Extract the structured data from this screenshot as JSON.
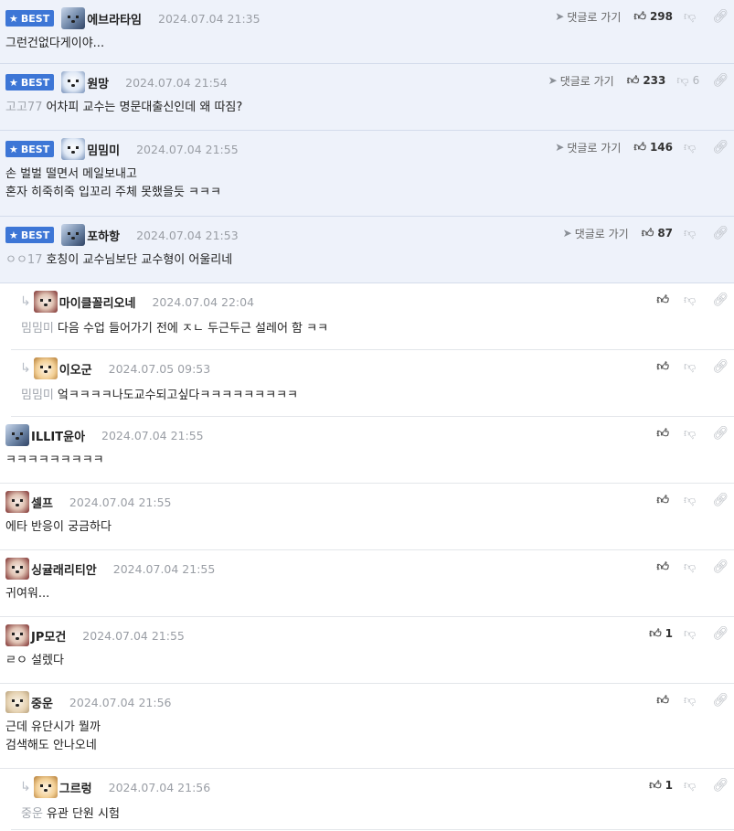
{
  "labels": {
    "best": "BEST",
    "goto": "댓글로 가기"
  },
  "icons": {
    "best_star": "star-icon",
    "goto": "send-arrow-icon",
    "up": "thumbs-up-icon",
    "down": "thumbs-down-icon",
    "link": "link-icon",
    "reply": "reply-arrow-icon"
  },
  "colors": {
    "best_badge": "#3d76d6",
    "best_bg": "#eef2fa"
  },
  "comments": [
    {
      "best": true,
      "reply": false,
      "avatar": "blue",
      "nick": "에브라타임",
      "date": "2024.07.04 21:35",
      "mention": "",
      "lines": [
        "그런건없다게이야..."
      ],
      "goto": true,
      "up": "298",
      "down": ""
    },
    {
      "best": true,
      "reply": false,
      "avatar": "white",
      "nick": "원망",
      "date": "2024.07.04 21:54",
      "mention": "고고77",
      "lines": [
        "어차피 교수는 명문대출신인데 왜 따짐?"
      ],
      "goto": true,
      "up": "233",
      "down": "6"
    },
    {
      "best": true,
      "reply": false,
      "avatar": "white",
      "nick": "밈밈미",
      "date": "2024.07.04 21:55",
      "mention": "",
      "lines": [
        "손 벌벌 떨면서 메일보내고",
        "혼자 히죽히죽 입꼬리 주체 못했을듯 ㅋㅋㅋ"
      ],
      "goto": true,
      "up": "146",
      "down": ""
    },
    {
      "best": true,
      "reply": false,
      "avatar": "blue",
      "nick": "포하항",
      "date": "2024.07.04 21:53",
      "mention": "ㅇㅇ17",
      "lines": [
        "호칭이 교수님보단 교수형이 어울리네"
      ],
      "goto": true,
      "up": "87",
      "down": ""
    },
    {
      "best": false,
      "reply": true,
      "avatar": "red",
      "nick": "마이클꼴리오네",
      "date": "2024.07.04 22:04",
      "mention": "밈밈미",
      "lines": [
        "다음 수업 들어가기 전에 ㅈㄴ 두근두근 설레어 함 ㅋㅋ"
      ],
      "goto": false,
      "up": "",
      "down": ""
    },
    {
      "best": false,
      "reply": true,
      "avatar": "fox",
      "nick": "이오군",
      "date": "2024.07.05 09:53",
      "mention": "밈밈미",
      "lines": [
        "엌ㅋㅋㅋㅋ나도교수되고싶다ㅋㅋㅋㅋㅋㅋㅋㅋㅋ"
      ],
      "goto": false,
      "up": "",
      "down": ""
    },
    {
      "best": false,
      "reply": false,
      "avatar": "blue",
      "nick": "ILLIT윤아",
      "date": "2024.07.04 21:55",
      "mention": "",
      "lines": [
        "ㅋㅋㅋㅋㅋㅋㅋㅋㅋ"
      ],
      "goto": false,
      "up": "",
      "down": ""
    },
    {
      "best": false,
      "reply": false,
      "avatar": "red",
      "nick": "셀프",
      "date": "2024.07.04 21:55",
      "mention": "",
      "lines": [
        "에타 반응이 궁금하다"
      ],
      "goto": false,
      "up": "",
      "down": ""
    },
    {
      "best": false,
      "reply": false,
      "avatar": "red",
      "nick": "싱귤래리티안",
      "date": "2024.07.04 21:55",
      "mention": "",
      "lines": [
        "귀여워..."
      ],
      "goto": false,
      "up": "",
      "down": ""
    },
    {
      "best": false,
      "reply": false,
      "avatar": "red",
      "nick": "JP모건",
      "date": "2024.07.04 21:55",
      "mention": "",
      "lines": [
        "ㄹㅇ 설렜다"
      ],
      "goto": false,
      "up": "1",
      "down": ""
    },
    {
      "best": false,
      "reply": false,
      "avatar": "dog",
      "nick": "중운",
      "date": "2024.07.04 21:56",
      "mention": "",
      "lines": [
        "근데 유단시가 뭘까",
        "검색해도 안나오네"
      ],
      "goto": false,
      "up": "",
      "down": ""
    },
    {
      "best": false,
      "reply": true,
      "avatar": "fox",
      "nick": "그르렁",
      "date": "2024.07.04 21:56",
      "mention": "중운",
      "lines": [
        "유관 단원 시험"
      ],
      "goto": false,
      "up": "1",
      "down": ""
    }
  ]
}
